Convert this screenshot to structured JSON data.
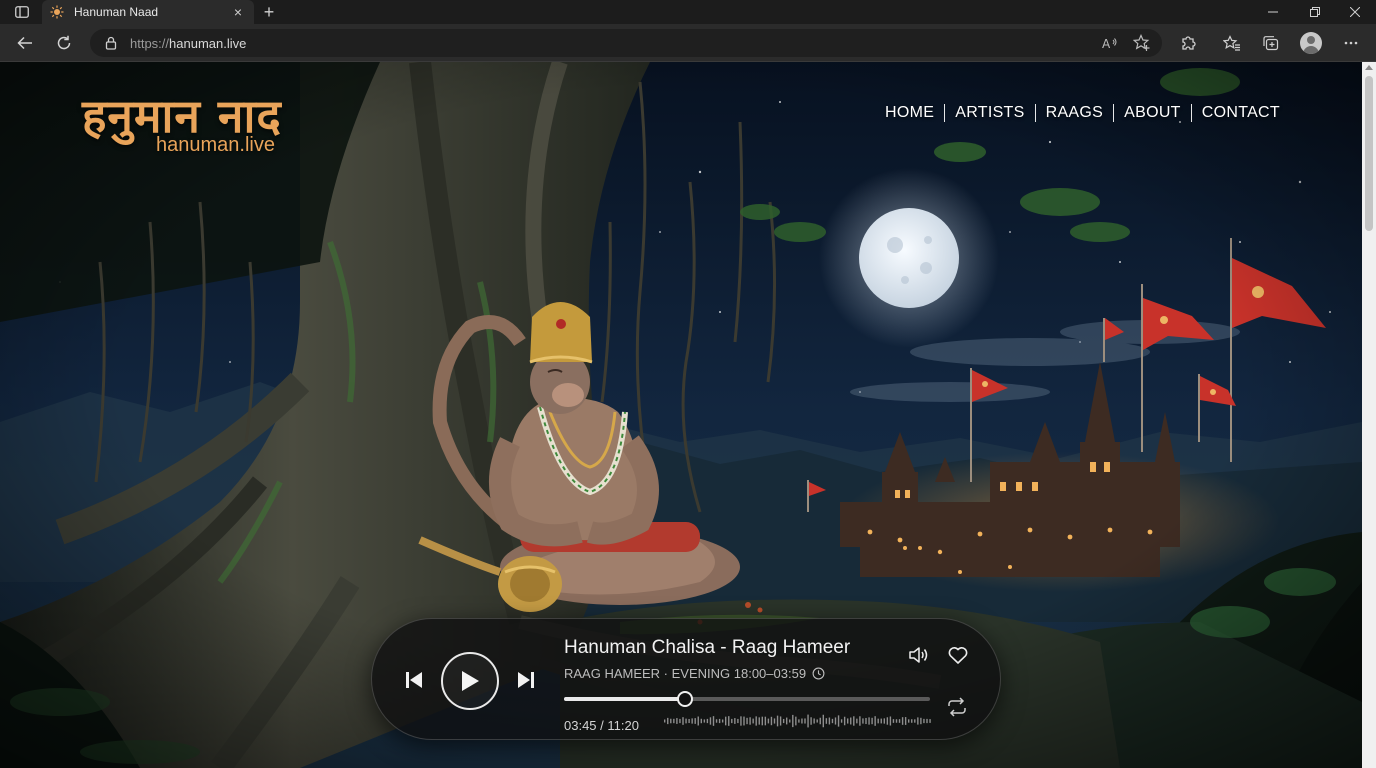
{
  "browser": {
    "tab_title": "Hanuman Naad",
    "tab_close": "×",
    "new_tab": "+",
    "url_scheme": "https://",
    "url_host": "hanuman.live"
  },
  "site": {
    "logo_devanagari": "हनुमान नाद",
    "logo_domain": "hanuman.live",
    "nav": [
      "HOME",
      "ARTISTS",
      "RAAGS",
      "ABOUT",
      "CONTACT"
    ]
  },
  "player": {
    "title": "Hanuman Chalisa - Raag Hameer",
    "meta": "RAAG HAMEER · EVENING 18:00–03:59",
    "time": "03:45 / 11:20",
    "progress": 0.33
  },
  "colors": {
    "accent": "#e9a45a",
    "flag": "#c8322a",
    "moon": "#eef2f6"
  },
  "icons": {
    "sidebar": "sidebar-icon",
    "favicon": "om-sun-icon",
    "back": "arrow-left-icon",
    "reload": "reload-icon",
    "lock": "lock-icon",
    "read_aloud": "read-aloud-icon",
    "add_favorite": "star-plus-icon",
    "extensions": "puzzle-icon",
    "favorites": "favorites-icon",
    "collections": "collections-icon",
    "profile": "avatar",
    "menu": "more-icon",
    "prev": "skip-previous-icon",
    "play": "play-icon",
    "next": "skip-next-icon",
    "clock": "clock-icon",
    "volume": "volume-icon",
    "heart": "heart-icon",
    "repeat": "repeat-icon"
  }
}
